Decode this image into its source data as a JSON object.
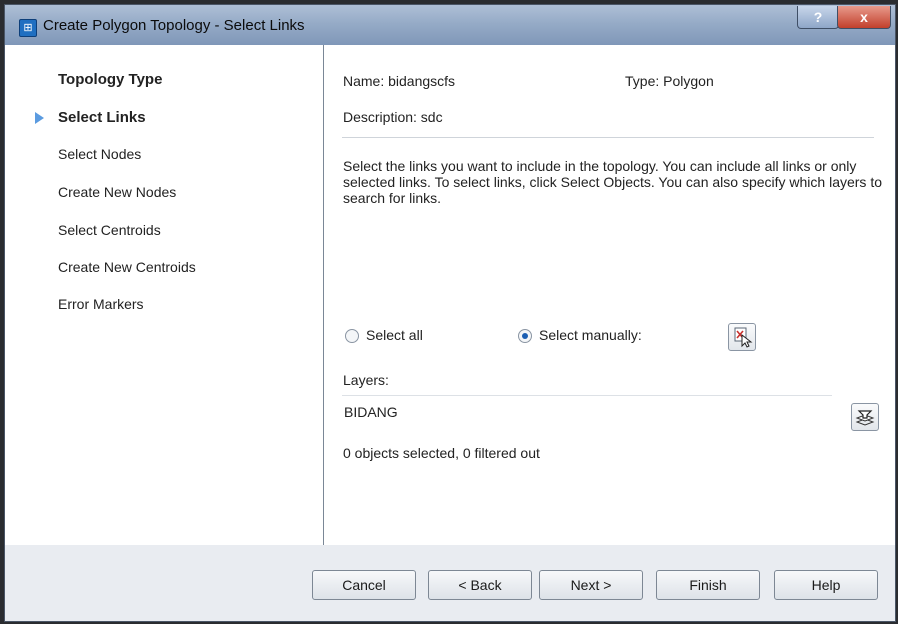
{
  "window": {
    "title": "Create Polygon Topology - Select Links",
    "help_label": "?",
    "close_label": "x"
  },
  "sidebar": {
    "items": [
      {
        "label": "Topology Type"
      },
      {
        "label": "Select Links",
        "current": true
      },
      {
        "label": "Select Nodes"
      },
      {
        "label": "Create New Nodes"
      },
      {
        "label": "Select Centroids"
      },
      {
        "label": "Create New Centroids"
      },
      {
        "label": "Error Markers"
      }
    ]
  },
  "details": {
    "name": "Name: bidangscfs",
    "type": "Type: Polygon",
    "description": "Description: sdc",
    "info": "Select the links you want to include in the topology. You can include all links or only selected links. To select links, click Select Objects. You can also specify which layers to search for links."
  },
  "selection": {
    "select_all_label": "Select all",
    "select_manually_label": "Select manually:",
    "selected_option": "Select manually:"
  },
  "layers": {
    "label": "Layers:",
    "value": "BIDANG",
    "status": "0 objects selected, 0 filtered out"
  },
  "footer": {
    "cancel": "Cancel",
    "back": "< Back",
    "next": "Next >",
    "finish": "Finish",
    "help": "Help"
  }
}
